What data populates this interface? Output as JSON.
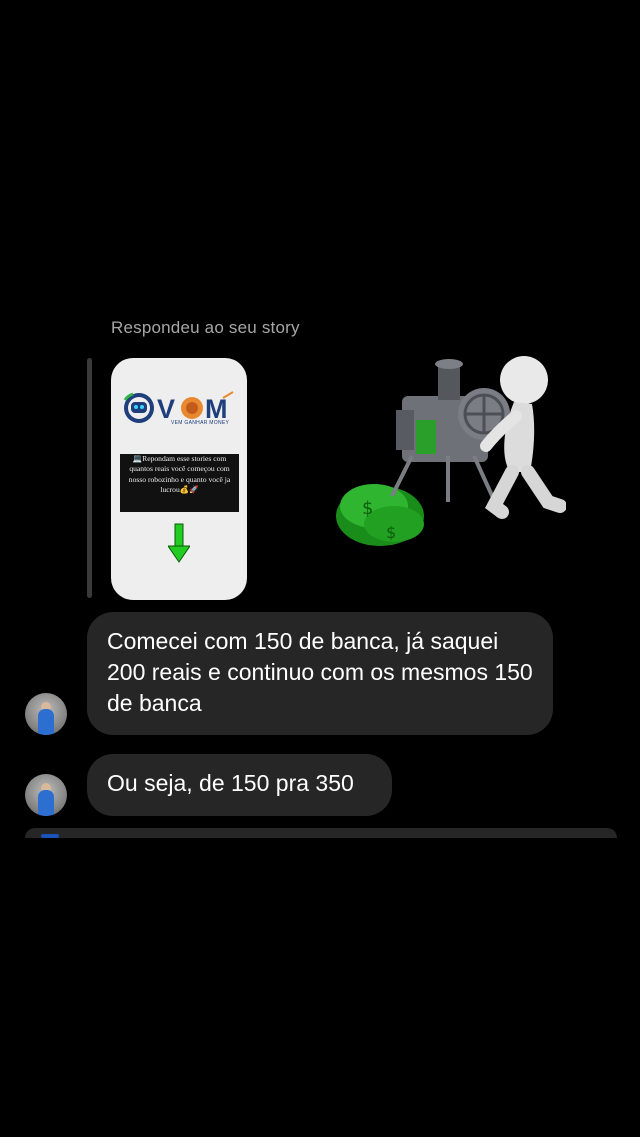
{
  "reply_context": {
    "label": "Respondeu ao seu story",
    "story": {
      "logo_text": "VOM",
      "logo_subtitle": "VEM GANHAR MONEY",
      "text": "💻Repondam esse stories com quantos reais você começou com nosso robozinho e quanto você ja lucrou💰🚀",
      "arrow_color": "#22cc22"
    },
    "sticker": "money-machine-sticker"
  },
  "messages": [
    {
      "text": "Comecei com 150 de banca, já saquei 200 reais e continuo com os mesmos 150 de banca"
    },
    {
      "text": "Ou seja, de 150 pra 350"
    }
  ],
  "colors": {
    "background": "#000000",
    "bubble": "#262626",
    "label": "#a6a6a6"
  }
}
